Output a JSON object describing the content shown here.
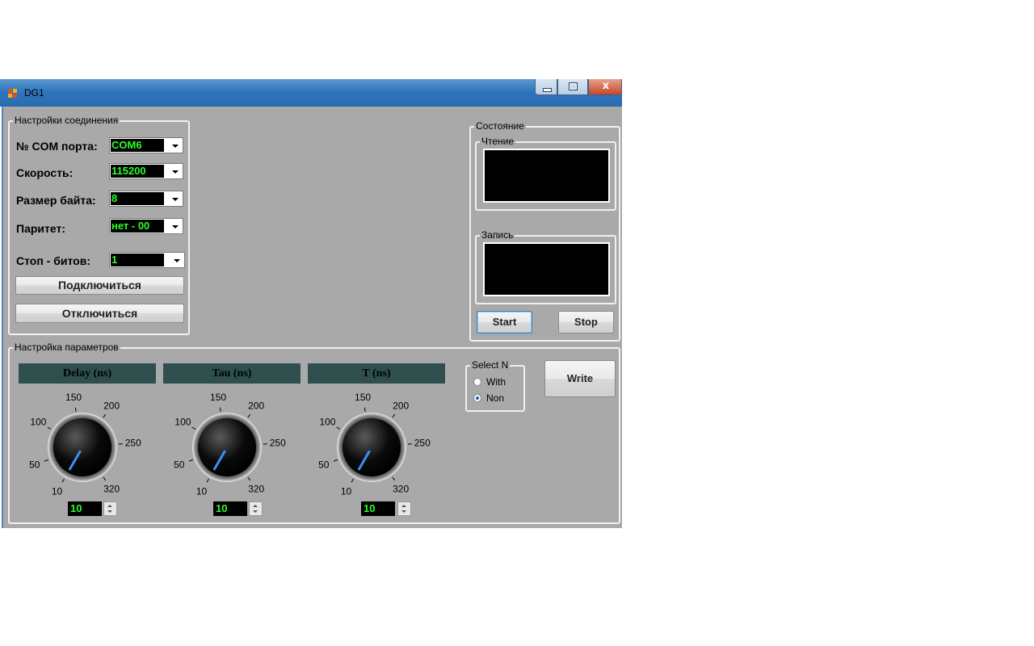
{
  "window": {
    "title": "DG1",
    "minimize_icon": "minimize-icon",
    "maximize_icon": "maximize-icon",
    "close_icon": "close-icon",
    "close_glyph": "x"
  },
  "connection": {
    "group_title": "Настройки соединения",
    "com_label": "№ COM порта:",
    "com_value": "COM6",
    "speed_label": "Скорость:",
    "speed_value": "115200",
    "bytesize_label": "Размер байта:",
    "bytesize_value": "8",
    "parity_label": "Паритет:",
    "parity_value": "нет - 00",
    "stopbits_label": "Стоп - битов:",
    "stopbits_value": "1",
    "connect_label": "Подключиться",
    "disconnect_label": "Отключиться"
  },
  "state": {
    "group_title": "Состояние",
    "read_title": "Чтение",
    "write_title": "Запись",
    "start_label": "Start",
    "stop_label": "Stop"
  },
  "params": {
    "group_title": "Настройка параметров",
    "knob_scale": [
      "10",
      "50",
      "100",
      "150",
      "200",
      "250",
      "320"
    ],
    "knobs": [
      {
        "header": "Delay (ns)",
        "value": "10"
      },
      {
        "header": "Tau (ns)",
        "value": "10"
      },
      {
        "header": "T (ns)",
        "value": "10"
      }
    ],
    "select_title": "Select N",
    "options": [
      {
        "label": "With",
        "selected": false
      },
      {
        "label": "Non",
        "selected": true
      }
    ],
    "write_label": "Write"
  },
  "colors": {
    "display_bg": "#000000",
    "display_text": "#2aff2a",
    "header_bg": "#2f4f4f",
    "panel_bg": "#a9a9a9"
  }
}
